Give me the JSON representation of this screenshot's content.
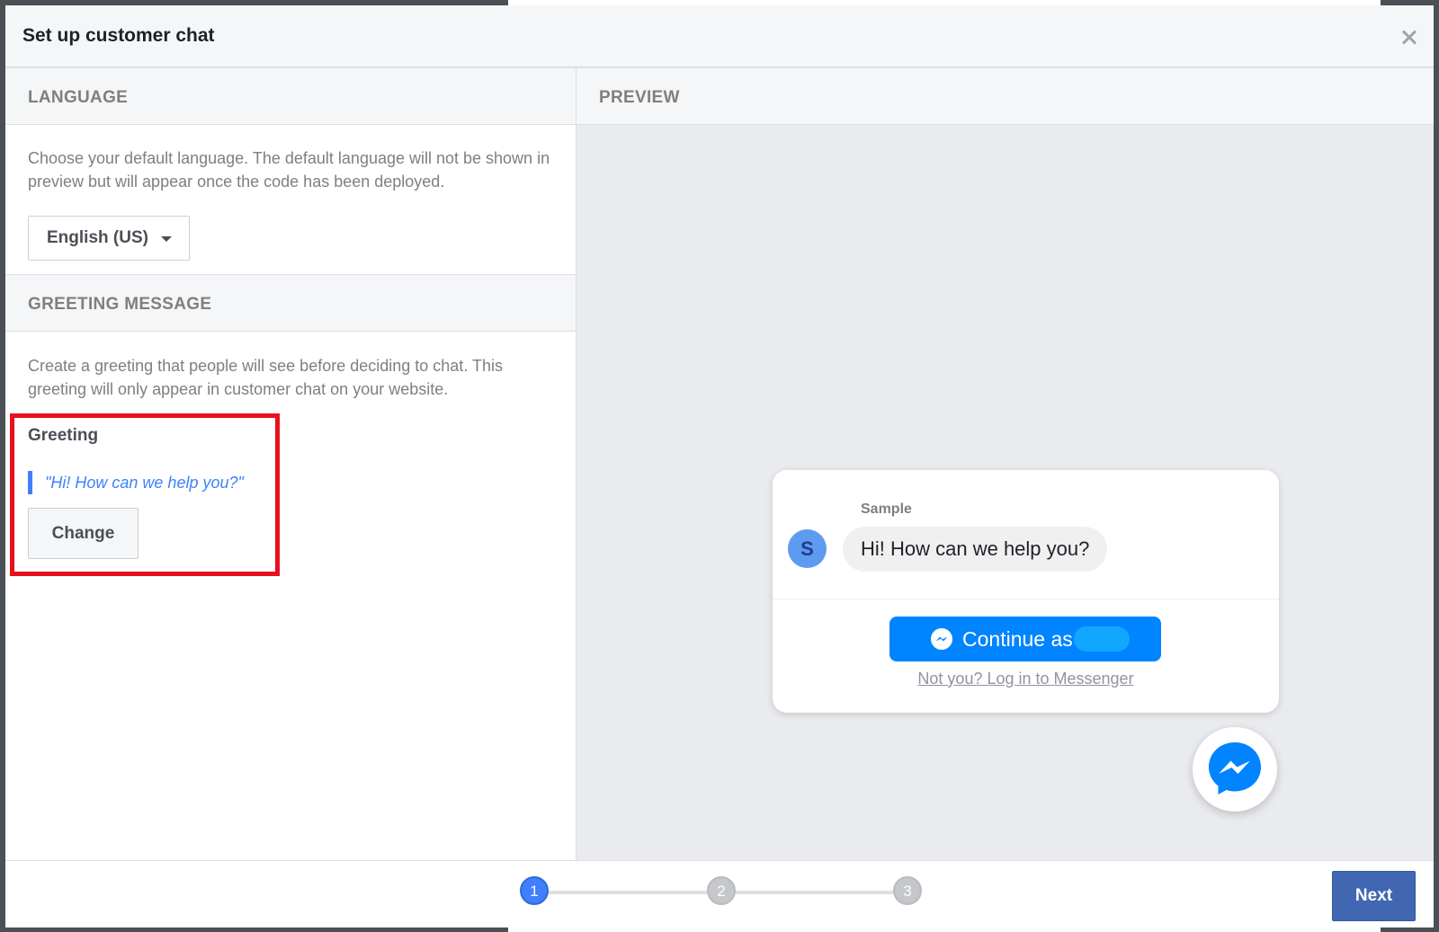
{
  "dialog": {
    "title": "Set up customer chat",
    "close_icon": "close-icon"
  },
  "language": {
    "heading": "LANGUAGE",
    "description": "Choose your default language. The default language will not be shown in preview but will appear once the code has been deployed.",
    "selected": "English (US)"
  },
  "greeting": {
    "heading": "GREETING MESSAGE",
    "description": "Create a greeting that people will see before deciding to chat. This greeting will only appear in customer chat on your website.",
    "label": "Greeting",
    "quote": "\"Hi! How can we help you?\"",
    "change_label": "Change"
  },
  "preview": {
    "heading": "PREVIEW",
    "sample_name": "Sample",
    "avatar_letter": "S",
    "bubble_text": "Hi! How can we help you?",
    "continue_label": "Continue as",
    "not_you_link": "Not you? Log in to Messenger"
  },
  "footer": {
    "steps": [
      "1",
      "2",
      "3"
    ],
    "active_step": 1,
    "next_label": "Next"
  },
  "colors": {
    "accent": "#4080ff",
    "messenger_blue": "#0084ff",
    "next_button": "#4267b2",
    "highlight": "#e8101d"
  }
}
